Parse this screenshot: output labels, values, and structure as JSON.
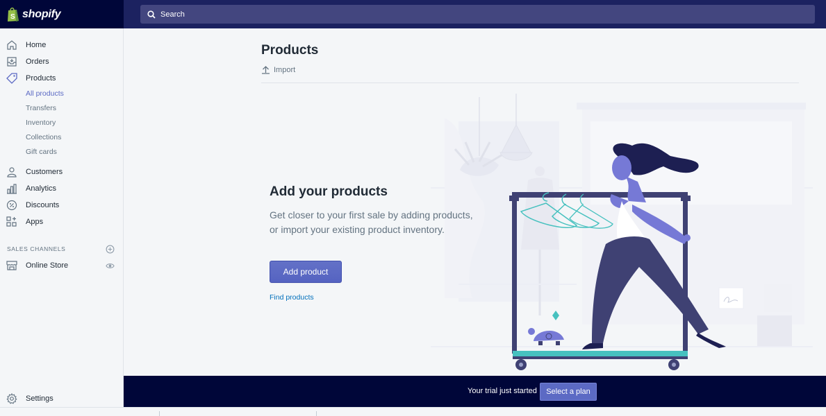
{
  "brand": {
    "name": "shopify",
    "bag_color": "#95bf47"
  },
  "search": {
    "placeholder": "Search"
  },
  "sidebar": {
    "items": [
      {
        "label": "Home",
        "icon": "home-icon"
      },
      {
        "label": "Orders",
        "icon": "orders-icon"
      },
      {
        "label": "Products",
        "icon": "tag-icon"
      }
    ],
    "product_subitems": [
      "All products",
      "Transfers",
      "Inventory",
      "Collections",
      "Gift cards"
    ],
    "more_items": [
      {
        "label": "Customers",
        "icon": "person-icon"
      },
      {
        "label": "Analytics",
        "icon": "bar-chart-icon"
      },
      {
        "label": "Discounts",
        "icon": "discount-icon"
      },
      {
        "label": "Apps",
        "icon": "apps-icon"
      }
    ],
    "sales_channels_title": "SALES CHANNELS",
    "online_store": "Online Store",
    "settings": "Settings"
  },
  "main": {
    "title": "Products",
    "import_label": "Import",
    "empty_title": "Add your products",
    "empty_text": "Get closer to your first sale by adding products, or import your existing product inventory.",
    "add_button": "Add product",
    "find_link": "Find products"
  },
  "trial": {
    "text": "Your trial just started",
    "button": "Select a plan"
  },
  "colors": {
    "topbar": "#1c2260",
    "accent": "#5c6ac4",
    "trialbar": "#000639"
  }
}
